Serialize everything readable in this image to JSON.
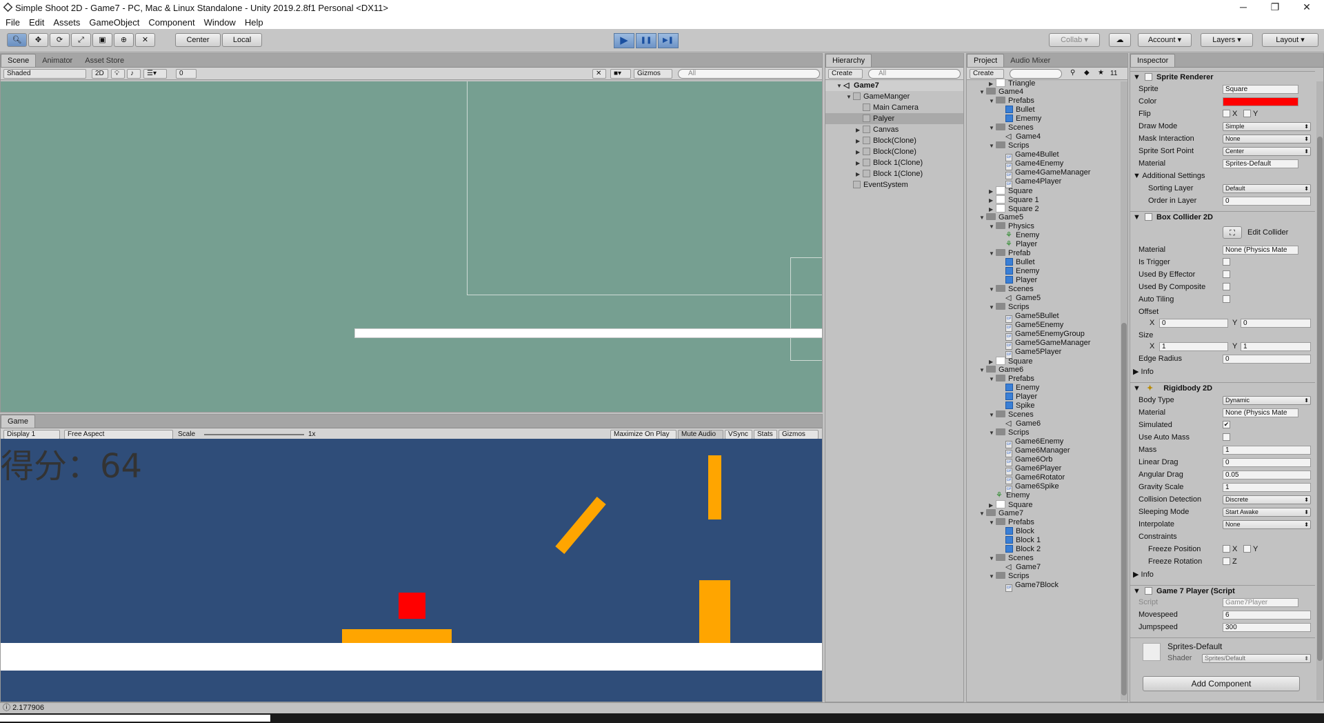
{
  "window": {
    "title": "Simple Shoot 2D - Game7 - PC, Mac & Linux Standalone - Unity 2019.2.8f1 Personal <DX11>",
    "controls": [
      "─",
      "❐",
      "✕"
    ]
  },
  "menu": [
    "File",
    "Edit",
    "Assets",
    "GameObject",
    "Component",
    "Window",
    "Help"
  ],
  "toolbar": {
    "pivot": "Center",
    "space": "Local",
    "collab": "Collab",
    "account": "Account",
    "layers": "Layers",
    "layout": "Layout",
    "play": "▶",
    "pause": "❚❚",
    "step": "▶❚"
  },
  "scene": {
    "tabs": [
      "Scene",
      "Animator",
      "Asset Store"
    ],
    "shading": "Shaded",
    "mode2d": "2D",
    "hidden_count": "0",
    "gizmos": "Gizmos",
    "search": "All",
    "bg_color": "#769f91"
  },
  "game": {
    "tab": "Game",
    "display": "Display 1",
    "aspect": "Free Aspect",
    "scale_label": "Scale",
    "scale_value": "1x",
    "buttons": [
      "Maximize On Play",
      "Mute Audio",
      "VSync",
      "Stats",
      "Gizmos"
    ],
    "score_text": "得分：64",
    "bg_color": "#2f4d79",
    "obstacle_color": "#ffa500",
    "player_color": "#ff0000"
  },
  "hierarchy": {
    "tab": "Hierarchy",
    "create": "Create",
    "search": "All",
    "scene_name": "Game7",
    "items": [
      {
        "label": "GameManger",
        "depth": 1,
        "arrow": "▼"
      },
      {
        "label": "Main Camera",
        "depth": 2,
        "arrow": ""
      },
      {
        "label": "Palyer",
        "depth": 2,
        "arrow": "",
        "selected": true
      },
      {
        "label": "Canvas",
        "depth": 2,
        "arrow": "▶"
      },
      {
        "label": "Block(Clone)",
        "depth": 2,
        "arrow": "▶"
      },
      {
        "label": "Block(Clone)",
        "depth": 2,
        "arrow": "▶"
      },
      {
        "label": "Block 1(Clone)",
        "depth": 2,
        "arrow": "▶"
      },
      {
        "label": "Block 1(Clone)",
        "depth": 2,
        "arrow": "▶"
      },
      {
        "label": "EventSystem",
        "depth": 1,
        "arrow": ""
      }
    ]
  },
  "project": {
    "tabs": [
      "Project",
      "Audio Mixer"
    ],
    "create": "Create",
    "hidden_count": "11",
    "items": [
      {
        "label": "Triangle",
        "depth": 1,
        "arrow": "▶",
        "icon": "sprite"
      },
      {
        "label": "Game4",
        "depth": 0,
        "arrow": "▼",
        "icon": "folder"
      },
      {
        "label": "Prefabs",
        "depth": 1,
        "arrow": "▼",
        "icon": "folder"
      },
      {
        "label": "Bullet",
        "depth": 2,
        "arrow": "",
        "icon": "prefab"
      },
      {
        "label": "Ememy",
        "depth": 2,
        "arrow": "",
        "icon": "prefab"
      },
      {
        "label": "Scenes",
        "depth": 1,
        "arrow": "▼",
        "icon": "folder"
      },
      {
        "label": "Game4",
        "depth": 2,
        "arrow": "",
        "icon": "unity"
      },
      {
        "label": "Scrips",
        "depth": 1,
        "arrow": "▼",
        "icon": "folder"
      },
      {
        "label": "Game4Bullet",
        "depth": 2,
        "arrow": "",
        "icon": "script"
      },
      {
        "label": "Game4Enemy",
        "depth": 2,
        "arrow": "",
        "icon": "script"
      },
      {
        "label": "Game4GameManager",
        "depth": 2,
        "arrow": "",
        "icon": "script"
      },
      {
        "label": "Game4Player",
        "depth": 2,
        "arrow": "",
        "icon": "script"
      },
      {
        "label": "Square",
        "depth": 1,
        "arrow": "▶",
        "icon": "sprite"
      },
      {
        "label": "Square 1",
        "depth": 1,
        "arrow": "▶",
        "icon": "sprite"
      },
      {
        "label": "Square 2",
        "depth": 1,
        "arrow": "▶",
        "icon": "sprite"
      },
      {
        "label": "Game5",
        "depth": 0,
        "arrow": "▼",
        "icon": "folder"
      },
      {
        "label": "Physics",
        "depth": 1,
        "arrow": "▼",
        "icon": "folder"
      },
      {
        "label": "Enemy",
        "depth": 2,
        "arrow": "",
        "icon": "physics"
      },
      {
        "label": "Player",
        "depth": 2,
        "arrow": "",
        "icon": "physics"
      },
      {
        "label": "Prefab",
        "depth": 1,
        "arrow": "▼",
        "icon": "folder"
      },
      {
        "label": "Bullet",
        "depth": 2,
        "arrow": "",
        "icon": "prefab"
      },
      {
        "label": "Enemy",
        "depth": 2,
        "arrow": "",
        "icon": "prefab"
      },
      {
        "label": "Player",
        "depth": 2,
        "arrow": "",
        "icon": "prefab"
      },
      {
        "label": "Scenes",
        "depth": 1,
        "arrow": "▼",
        "icon": "folder"
      },
      {
        "label": "Game5",
        "depth": 2,
        "arrow": "",
        "icon": "unity"
      },
      {
        "label": "Scrips",
        "depth": 1,
        "arrow": "▼",
        "icon": "folder"
      },
      {
        "label": "Game5Bullet",
        "depth": 2,
        "arrow": "",
        "icon": "script"
      },
      {
        "label": "Game5Enemy",
        "depth": 2,
        "arrow": "",
        "icon": "script"
      },
      {
        "label": "Game5EnemyGroup",
        "depth": 2,
        "arrow": "",
        "icon": "script"
      },
      {
        "label": "Game5GameManager",
        "depth": 2,
        "arrow": "",
        "icon": "script"
      },
      {
        "label": "Game5Player",
        "depth": 2,
        "arrow": "",
        "icon": "script"
      },
      {
        "label": "Square",
        "depth": 1,
        "arrow": "▶",
        "icon": "sprite"
      },
      {
        "label": "Game6",
        "depth": 0,
        "arrow": "▼",
        "icon": "folder"
      },
      {
        "label": "Prefabs",
        "depth": 1,
        "arrow": "▼",
        "icon": "folder"
      },
      {
        "label": "Enemy",
        "depth": 2,
        "arrow": "",
        "icon": "prefab"
      },
      {
        "label": "Player",
        "depth": 2,
        "arrow": "",
        "icon": "prefab"
      },
      {
        "label": "Spike",
        "depth": 2,
        "arrow": "",
        "icon": "prefab"
      },
      {
        "label": "Scenes",
        "depth": 1,
        "arrow": "▼",
        "icon": "folder"
      },
      {
        "label": "Game6",
        "depth": 2,
        "arrow": "",
        "icon": "unity"
      },
      {
        "label": "Scrips",
        "depth": 1,
        "arrow": "▼",
        "icon": "folder"
      },
      {
        "label": "Game6Enemy",
        "depth": 2,
        "arrow": "",
        "icon": "script"
      },
      {
        "label": "Game6Manager",
        "depth": 2,
        "arrow": "",
        "icon": "script"
      },
      {
        "label": "Game6Orb",
        "depth": 2,
        "arrow": "",
        "icon": "script"
      },
      {
        "label": "Game6Player",
        "depth": 2,
        "arrow": "",
        "icon": "script"
      },
      {
        "label": "Game6Rotator",
        "depth": 2,
        "arrow": "",
        "icon": "script"
      },
      {
        "label": "Game6Spike",
        "depth": 2,
        "arrow": "",
        "icon": "script"
      },
      {
        "label": "Enemy",
        "depth": 1,
        "arrow": "",
        "icon": "physics"
      },
      {
        "label": "Square",
        "depth": 1,
        "arrow": "▶",
        "icon": "sprite"
      },
      {
        "label": "Game7",
        "depth": 0,
        "arrow": "▼",
        "icon": "folder"
      },
      {
        "label": "Prefabs",
        "depth": 1,
        "arrow": "▼",
        "icon": "folder"
      },
      {
        "label": "Block",
        "depth": 2,
        "arrow": "",
        "icon": "prefab"
      },
      {
        "label": "Block 1",
        "depth": 2,
        "arrow": "",
        "icon": "prefab"
      },
      {
        "label": "Block 2",
        "depth": 2,
        "arrow": "",
        "icon": "prefab"
      },
      {
        "label": "Scenes",
        "depth": 1,
        "arrow": "▼",
        "icon": "folder"
      },
      {
        "label": "Game7",
        "depth": 2,
        "arrow": "",
        "icon": "unity"
      },
      {
        "label": "Scrips",
        "depth": 1,
        "arrow": "▼",
        "icon": "folder"
      },
      {
        "label": "Game7Block",
        "depth": 2,
        "arrow": "",
        "icon": "script"
      }
    ]
  },
  "inspector": {
    "tab": "Inspector",
    "sprite_renderer": {
      "title": "Sprite Renderer",
      "sprite_label": "Sprite",
      "sprite_value": "Square",
      "color_label": "Color",
      "color_value": "#ff0000",
      "flip_label": "Flip",
      "flip_x": "X",
      "flip_y": "Y",
      "draw_mode_label": "Draw Mode",
      "draw_mode_value": "Simple",
      "mask_label": "Mask Interaction",
      "mask_value": "None",
      "sort_point_label": "Sprite Sort Point",
      "sort_point_value": "Center",
      "material_label": "Material",
      "material_value": "Sprites-Default",
      "additional": "Additional Settings",
      "sorting_layer_label": "Sorting Layer",
      "sorting_layer_value": "Default",
      "order_label": "Order in Layer",
      "order_value": "0"
    },
    "box_collider": {
      "title": "Box Collider 2D",
      "edit_collider": "Edit Collider",
      "material_label": "Material",
      "material_value": "None (Physics Mate",
      "is_trigger": "Is Trigger",
      "used_by_effector": "Used By Effector",
      "used_by_composite": "Used By Composite",
      "auto_tiling": "Auto Tiling",
      "offset_label": "Offset",
      "offset_x": "0",
      "offset_y": "0",
      "size_label": "Size",
      "size_x": "1",
      "size_y": "1",
      "edge_radius_label": "Edge Radius",
      "edge_radius_value": "0",
      "info": "Info",
      "x": "X",
      "y": "Y"
    },
    "rigidbody": {
      "title": "Rigidbody 2D",
      "body_type_label": "Body Type",
      "body_type_value": "Dynamic",
      "material_label": "Material",
      "material_value": "None (Physics Mate",
      "simulated": "Simulated",
      "use_auto_mass": "Use Auto Mass",
      "mass_label": "Mass",
      "mass_value": "1",
      "linear_drag_label": "Linear Drag",
      "linear_drag_value": "0",
      "angular_drag_label": "Angular Drag",
      "angular_drag_value": "0.05",
      "gravity_label": "Gravity Scale",
      "gravity_value": "1",
      "collision_label": "Collision Detection",
      "collision_value": "Discrete",
      "sleeping_label": "Sleeping Mode",
      "sleeping_value": "Start Awake",
      "interpolate_label": "Interpolate",
      "interpolate_value": "None",
      "constraints": "Constraints",
      "freeze_position": "Freeze Position",
      "freeze_rotation": "Freeze Rotation",
      "x": "X",
      "y": "Y",
      "z": "Z",
      "info": "Info"
    },
    "player_script": {
      "title": "Game 7 Player (Script",
      "script_label": "Script",
      "script_value": "Game7Player",
      "movespeed_label": "Movespeed",
      "movespeed_value": "6",
      "jumpspeed_label": "Jumpspeed",
      "jumpspeed_value": "300"
    },
    "material": {
      "name": "Sprites-Default",
      "shader_label": "Shader",
      "shader_value": "Sprites/Default"
    },
    "add_component": "Add Component"
  },
  "status": {
    "message": "2.177906"
  }
}
